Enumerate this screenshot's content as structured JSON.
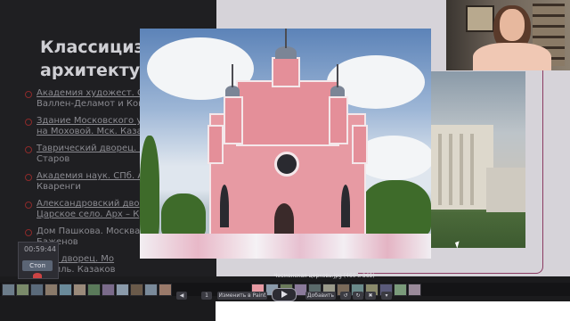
{
  "slide": {
    "title": "Классициз\nархитекту",
    "bullets": [
      {
        "line1": "Академия художест. С",
        "line2": "Валлен-Деламот и Кок"
      },
      {
        "line1": "Здание Московского у",
        "line2": "на Моховой. Мск. Казак"
      },
      {
        "line1": "Таврический дворец. С",
        "line2": "Старов"
      },
      {
        "line1": "Академия наук. СПб. А",
        "line2": "Кваренги"
      },
      {
        "line1": "Александровский двор",
        "line2": "Царское село. Арх – К"
      },
      {
        "line1": "Дом Пашкова. Москва",
        "line2": "Баженов"
      },
      {
        "line1": "ский дворец. Мо",
        "line2": "Кремль. Казаков"
      }
    ]
  },
  "recorder": {
    "time": "00:59:44",
    "stop_label": "Стоп"
  },
  "viewer": {
    "caption": "Чесменская церковь.jpg (460 x 365)"
  },
  "controls": {
    "prev": "◀",
    "counter": "1",
    "edit_in_paint": "Изменить в Paint",
    "add": "Добавить",
    "rotate_left": "↺",
    "rotate_right": "↻",
    "delete": "✖",
    "more": "▾"
  },
  "icons": [
    "play-icon",
    "prev-icon",
    "rotate-left-icon",
    "rotate-right-icon",
    "delete-icon"
  ],
  "colors": {
    "accent": "#8b3b62",
    "bullet": "#8c2a2a",
    "background": "#1f1f22"
  }
}
